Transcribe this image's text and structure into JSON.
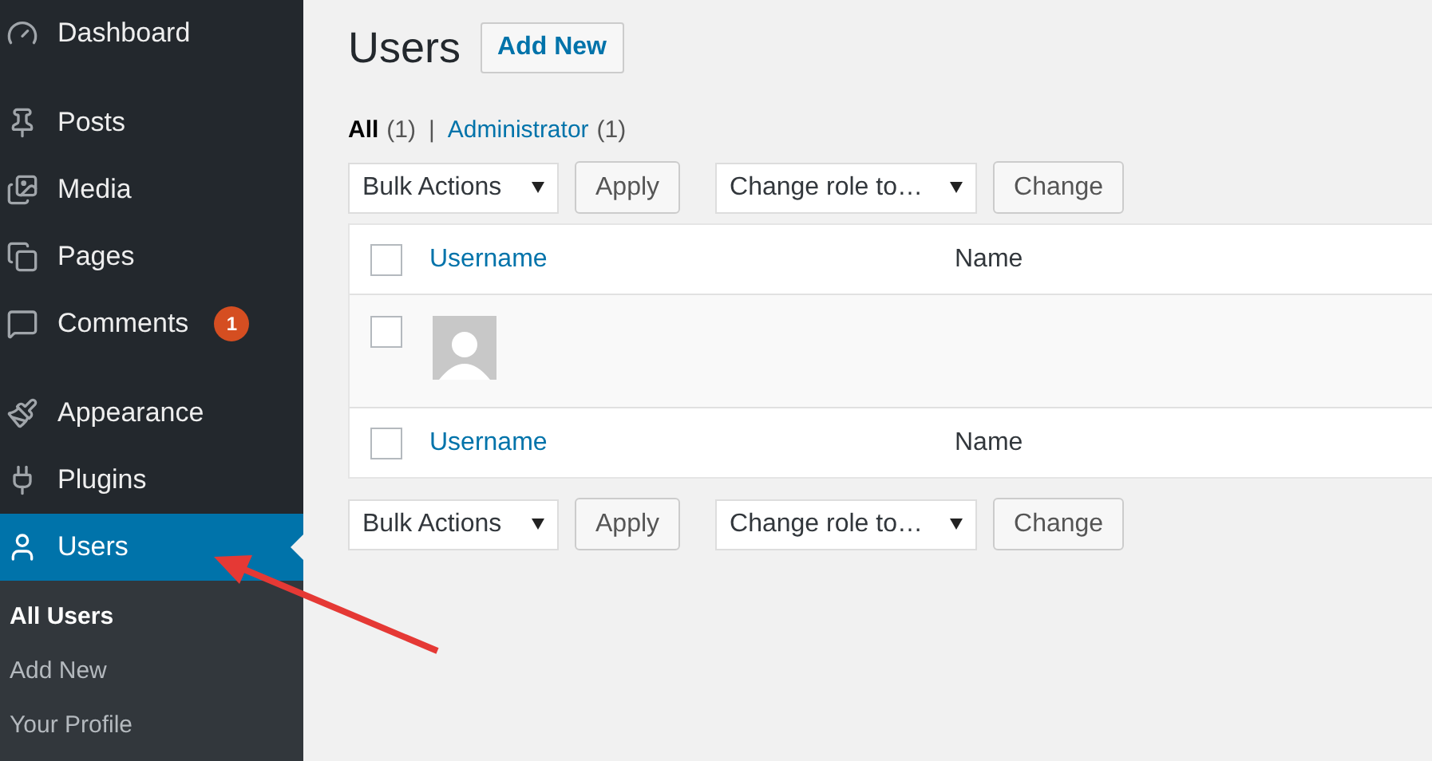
{
  "sidebar": {
    "sections": [
      {
        "items": [
          {
            "label": "Dashboard",
            "selected": false
          }
        ]
      },
      {
        "items": [
          {
            "label": "Posts",
            "selected": false
          },
          {
            "label": "Media",
            "selected": false
          },
          {
            "label": "Pages",
            "selected": false
          },
          {
            "label": "Comments",
            "badge": "1",
            "selected": false
          }
        ]
      },
      {
        "items": [
          {
            "label": "Appearance",
            "selected": false
          },
          {
            "label": "Plugins",
            "selected": false
          },
          {
            "label": "Users",
            "selected": true,
            "children": [
              {
                "label": "All Users",
                "selected": true
              },
              {
                "label": "Add New",
                "selected": false
              },
              {
                "label": "Your Profile",
                "selected": false
              }
            ]
          }
        ]
      }
    ]
  },
  "page": {
    "title": "Users",
    "add_button": "Add New",
    "filters": [
      {
        "label": "All",
        "count": "(1)",
        "selected": true
      },
      {
        "label": "Administrator",
        "count": "(1)",
        "selected": false
      }
    ],
    "filter_separator": "|",
    "actions_top": {
      "bulk": "Bulk Actions",
      "apply": "Apply",
      "role": "Change role to…",
      "change": "Change"
    },
    "table": {
      "header": {
        "username": "Username",
        "name": "Name",
        "checked": false
      },
      "rows": [
        {
          "checked": false
        }
      ],
      "footer": {
        "username": "Username",
        "name": "Name",
        "checked": false
      }
    },
    "actions_bottom": {
      "bulk": "Bulk Actions",
      "apply": "Apply",
      "role": "Change role to…",
      "change": "Change"
    }
  }
}
